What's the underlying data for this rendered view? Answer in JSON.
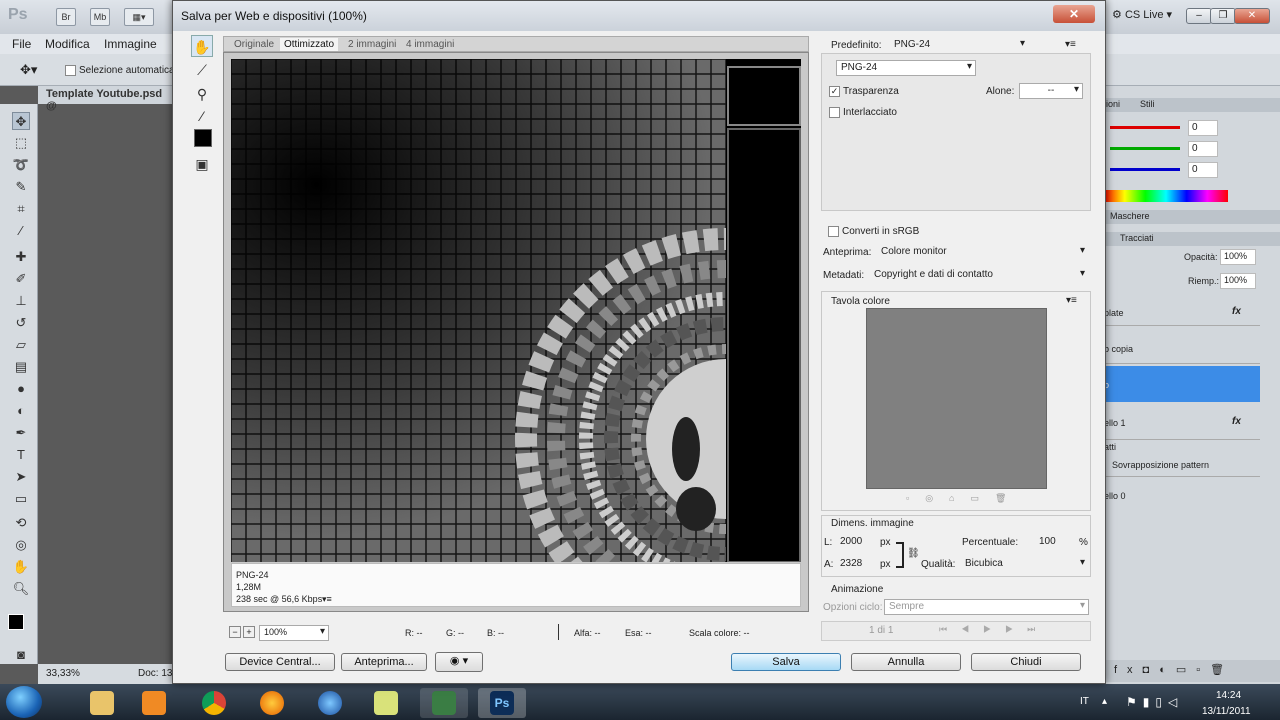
{
  "photoshop": {
    "logo": "Ps",
    "top_buttons": [
      "Br",
      "Mb"
    ],
    "cs_live": "CS Live",
    "menu": [
      "File",
      "Modifica",
      "Immagine"
    ],
    "options_checkbox": "Selezione automatica:",
    "doc_tab": "Template Youtube.psd @",
    "zoom_status": "33,33%",
    "doc_status": "Doc: 13",
    "panels": {
      "tabs1": [
        "ioni",
        "Stili"
      ],
      "color_values": [
        "0",
        "0",
        "0"
      ],
      "tab2": "Maschere",
      "tab3": "Tracciati",
      "opacity_label": "Opacità:",
      "opacity_value": "100%",
      "fill_label": "Riemp.:",
      "fill_value": "100%",
      "layers": [
        "plate",
        "b copia",
        "o",
        "ello 1",
        "atti",
        "Sovrapposizione pattern",
        "ello 0"
      ]
    }
  },
  "dialog": {
    "title": "Salva per Web e dispositivi (100%)",
    "view_tabs": [
      "Originale",
      "Ottimizzato",
      "2 immagini",
      "4 immagini"
    ],
    "active_tab": "Ottimizzato",
    "info": {
      "format": "PNG-24",
      "size": "1,28M",
      "time": "238 sec @ 56,6 Kbps"
    },
    "zoom": "100%",
    "stats": {
      "r": "R: --",
      "g": "G: --",
      "b": "B: --",
      "alfa": "Alfa: --",
      "esa": "Esa: --",
      "scala": "Scala colore: --"
    },
    "buttons": {
      "device_central": "Device Central...",
      "anteprima": "Anteprima...",
      "salva": "Salva",
      "annulla": "Annulla",
      "chiudi": "Chiudi"
    },
    "settings": {
      "preset_label": "Predefinito:",
      "preset_value": "PNG-24",
      "format_value": "PNG-24",
      "trasparenza": "Trasparenza",
      "trasparenza_checked": true,
      "alone_label": "Alone:",
      "alone_value": "--",
      "interlacciato": "Interlacciato",
      "interlacciato_checked": false,
      "converti_srgb": "Converti in sRGB",
      "anteprima_label": "Anteprima:",
      "anteprima_value": "Colore monitor",
      "metadati_label": "Metadati:",
      "metadati_value": "Copyright e dati di contatto",
      "tavola_colore": "Tavola colore",
      "dimens_title": "Dimens. immagine",
      "l_label": "L:",
      "l_value": "2000",
      "a_label": "A:",
      "a_value": "2328",
      "px": "px",
      "percentuale_label": "Percentuale:",
      "percentuale_value": "100",
      "percent": "%",
      "qualita_label": "Qualità:",
      "qualita_value": "Bicubica",
      "animazione_title": "Animazione",
      "opzioni_ciclo_label": "Opzioni ciclo:",
      "opzioni_ciclo_value": "Sempre",
      "frame_counter": "1 di 1"
    }
  },
  "taskbar": {
    "language": "IT",
    "time": "14:24",
    "date": "13/11/2011",
    "apps": [
      "explorer",
      "media-player",
      "chrome",
      "firefox",
      "photoshop-alt",
      "notes",
      "video",
      "photoshop"
    ]
  }
}
